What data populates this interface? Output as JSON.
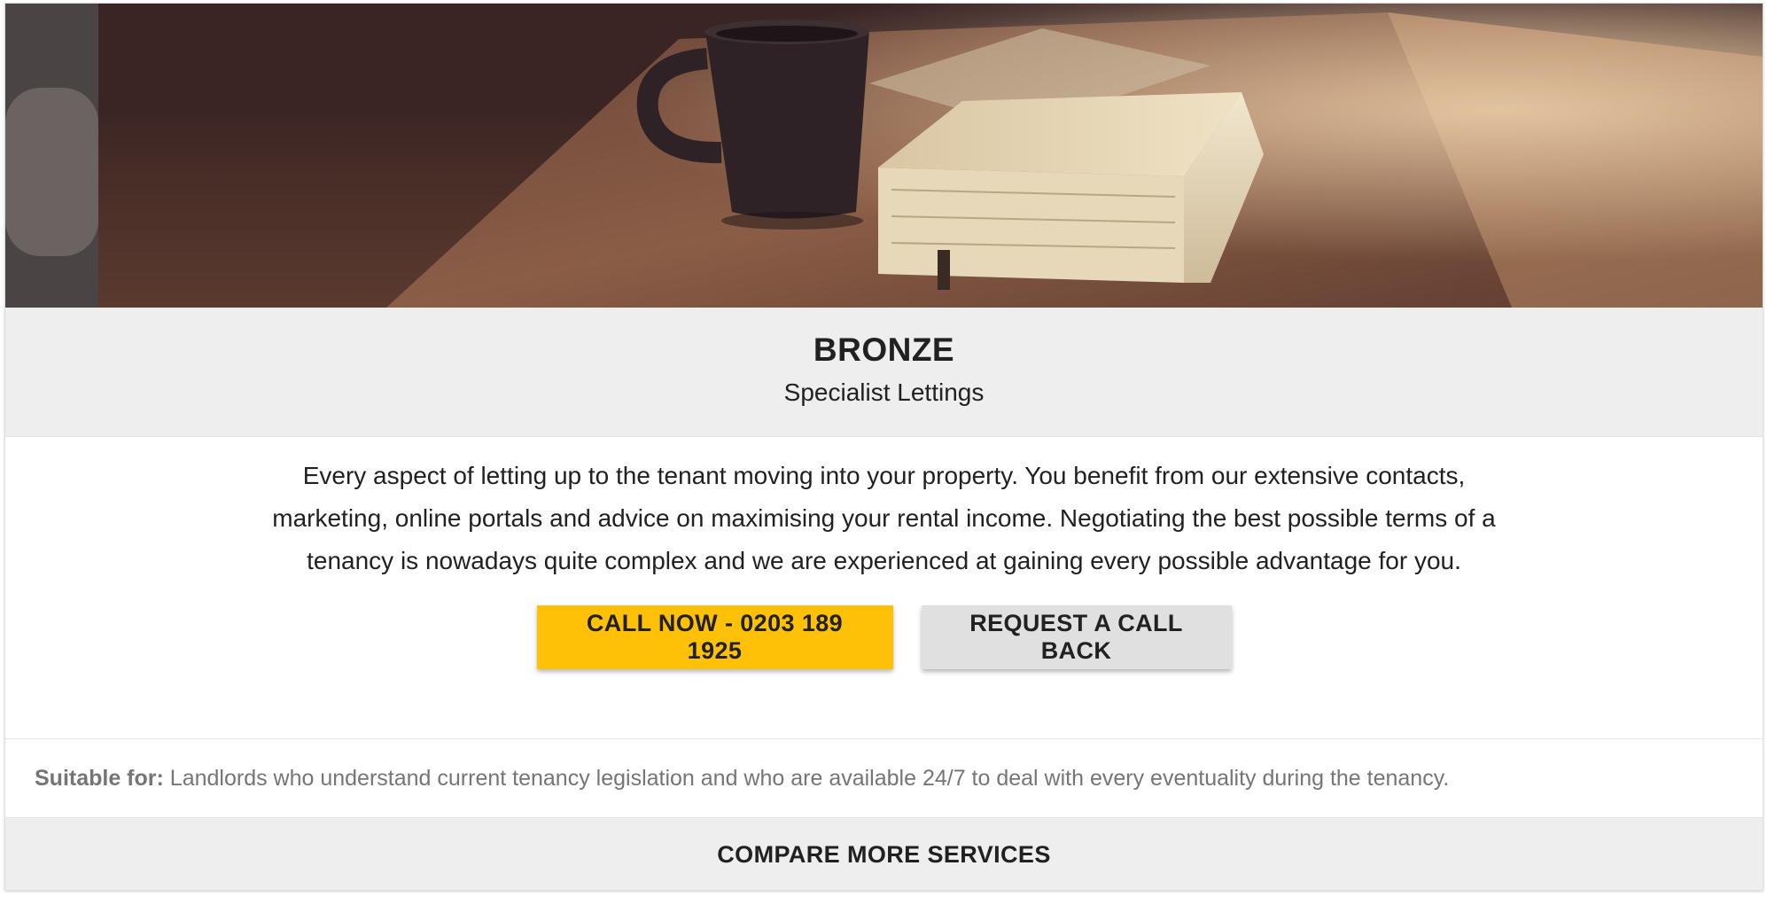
{
  "card": {
    "title": "BRONZE",
    "subtitle": "Specialist Lettings",
    "description": "Every aspect of letting up to the tenant moving into your property. You benefit from our extensive contacts, marketing, online portals and advice on maximising your rental income. Negotiating the best possible terms of a tenancy is nowadays quite complex and we are experienced at gaining every possible advantage for you.",
    "call_now_label": "CALL NOW - 0203 189 1925",
    "request_callback_label": "REQUEST A CALL BACK",
    "suitable_label": "Suitable for:",
    "suitable_text": " Landlords who understand current tenancy legislation and who are available 24/7 to deal with every eventuality during the tenancy.",
    "compare_label": "COMPARE MORE SERVICES"
  },
  "colors": {
    "primary_button": "#ffc107",
    "secondary_button": "#e0e0e0",
    "band_background": "#eeeeee"
  }
}
